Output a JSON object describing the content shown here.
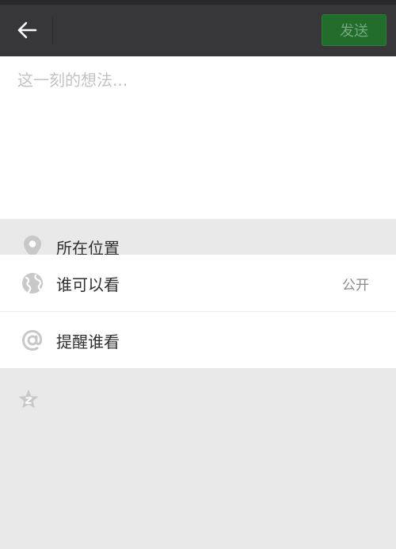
{
  "header": {
    "back_icon": "arrow-left-icon",
    "send_label": "发送",
    "send_color": "#226c2c"
  },
  "composer": {
    "placeholder": "这一刻的想法..."
  },
  "location": {
    "icon": "location-pin-icon",
    "label": "所在位置"
  },
  "visibility": {
    "icon": "globe-icon",
    "label": "谁可以看",
    "value": "公开"
  },
  "remind": {
    "icon": "at-sign-icon",
    "label": "提醒谁看"
  },
  "extra": {
    "icon": "star-icon"
  }
}
